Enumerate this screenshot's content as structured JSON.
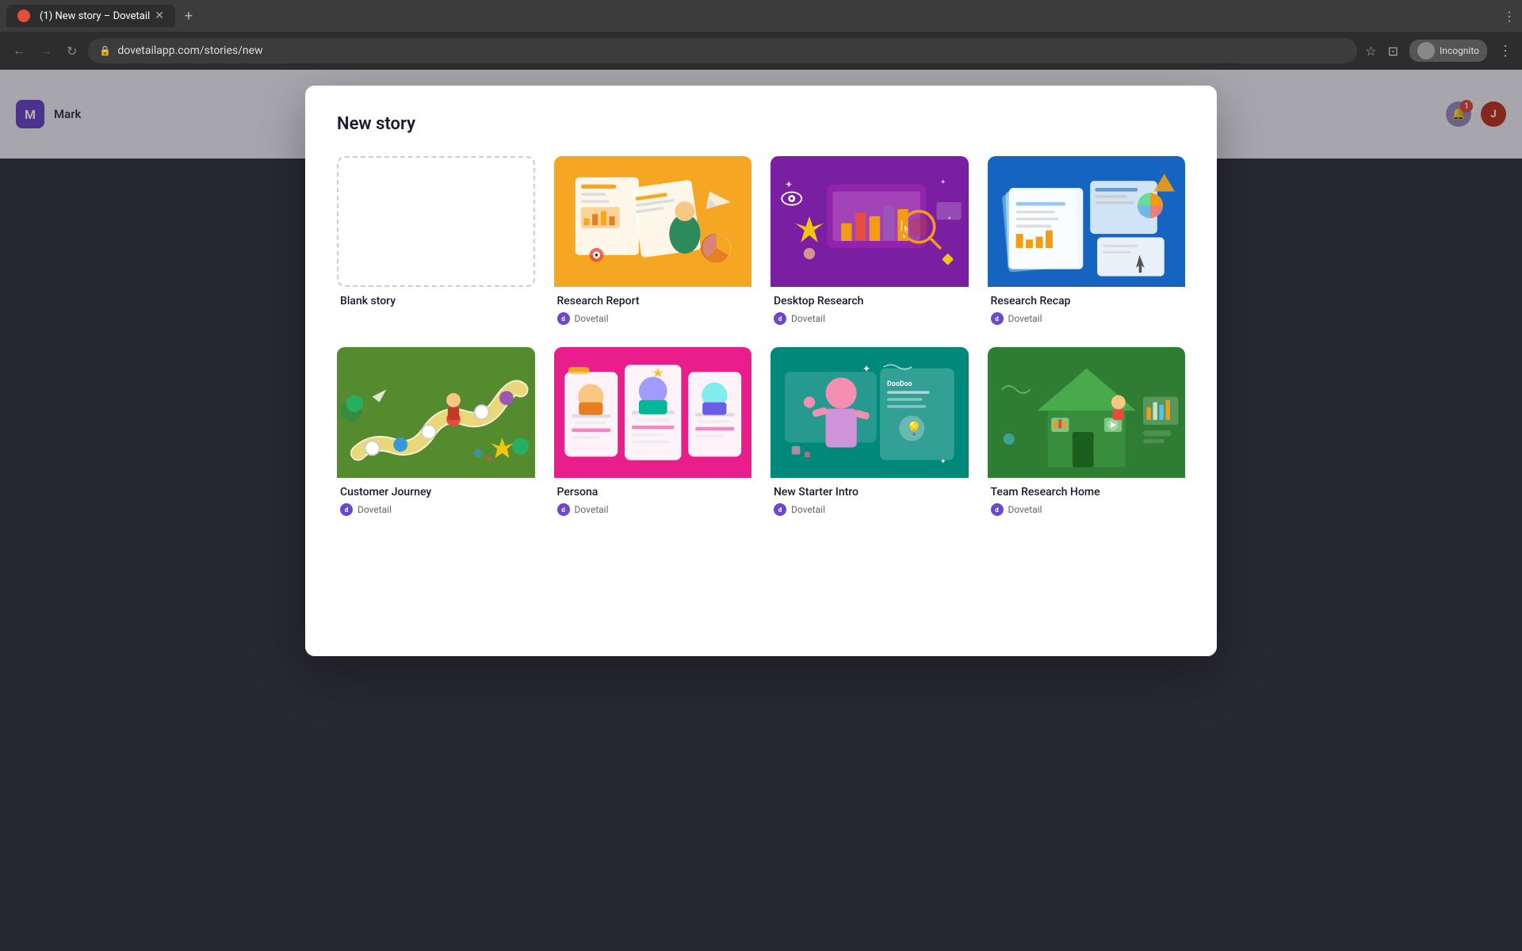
{
  "browser": {
    "tab_title": "(1) New story – Dovetail",
    "url": "dovetailapp.com/stories/new",
    "incognito_label": "Incognito",
    "new_tab_icon": "+",
    "back_icon": "←",
    "forward_icon": "→",
    "reload_icon": "↺"
  },
  "app": {
    "workspace_initial": "M",
    "workspace_name": "Mark",
    "notification_count": "1"
  },
  "modal": {
    "title": "New story",
    "templates": [
      {
        "id": "blank",
        "name": "Blank story",
        "author": "",
        "color": "blank"
      },
      {
        "id": "research-report",
        "name": "Research Report",
        "author": "Dovetail",
        "color": "#F5A623"
      },
      {
        "id": "desktop-research",
        "name": "Desktop Research",
        "author": "Dovetail",
        "color": "#7B1FA2"
      },
      {
        "id": "research-recap",
        "name": "Research Recap",
        "author": "Dovetail",
        "color": "#1565C0"
      },
      {
        "id": "customer-journey",
        "name": "Customer Journey",
        "author": "Dovetail",
        "color": "#558B2F"
      },
      {
        "id": "persona",
        "name": "Persona",
        "author": "Dovetail",
        "color": "#E91E8C"
      },
      {
        "id": "new-starter-intro",
        "name": "New Starter Intro",
        "author": "Dovetail",
        "color": "#00897B"
      },
      {
        "id": "team-research-home",
        "name": "Team Research Home",
        "author": "Dovetail",
        "color": "#2E7D32"
      }
    ]
  }
}
